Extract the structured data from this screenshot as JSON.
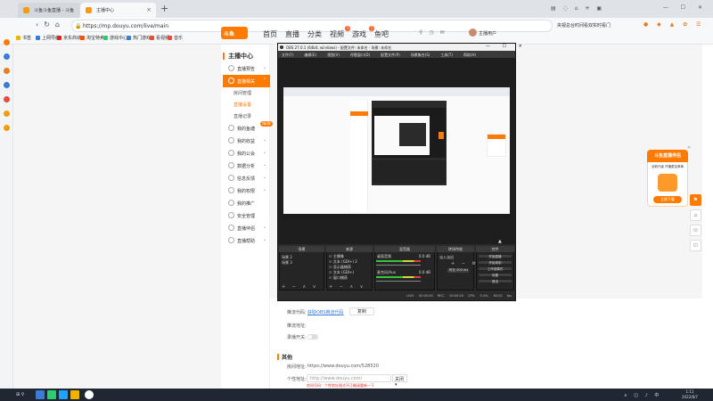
{
  "browser": {
    "tabs": [
      {
        "label": "斗鱼斗鱼直播 - 斗鱼"
      },
      {
        "label": "主播中心"
      }
    ],
    "new_tab": "+",
    "window_controls": "— ☐ ✕",
    "tab_icons": "▤ ◌ ⌂ ✳ ▣",
    "url": "https://mp.douyu.com/live/main",
    "search_hint": "央视总台时间看双实时看门",
    "bookmarks": [
      "书签",
      "上网导航",
      "京东商城",
      "淘宝特卖",
      "游戏中心",
      "热门游戏",
      "看视频",
      "音乐"
    ],
    "colors": {
      "accent": "#ff7a00"
    }
  },
  "site": {
    "logo": "斗鱼",
    "nav": [
      "首页",
      "直播",
      "分类",
      "视频",
      "游戏",
      "鱼吧"
    ],
    "nav_badges": {
      "video": "3",
      "game": "1"
    },
    "username": "主播用户"
  },
  "sidemenu": {
    "title": "主播中心",
    "items": [
      {
        "label": "直播预告",
        "chevron": "⌄"
      },
      {
        "label": "直播相关",
        "chevron": "⌃",
        "active": true
      },
      {
        "label": "我的鱼塘",
        "badge": "NEW"
      },
      {
        "label": "我的收益",
        "chevron": "⌄"
      },
      {
        "label": "我的公会",
        "chevron": "⌄"
      },
      {
        "label": "数据分析",
        "chevron": "⌄"
      },
      {
        "label": "信息反馈",
        "chevron": "⌄"
      },
      {
        "label": "我的权限",
        "chevron": "⌄"
      },
      {
        "label": "我的推广"
      },
      {
        "label": "安全管理"
      },
      {
        "label": "直播伴侣",
        "chevron": "⌄"
      },
      {
        "label": "直播帮助",
        "chevron": "⌄"
      }
    ],
    "subitems": [
      "房间管理",
      "直播设置",
      "直播记录"
    ]
  },
  "content": {
    "row1_label": "推流代码:",
    "row1_link": "获取OBS推流代码",
    "row1_btn": "复制",
    "row2_label": "推流地址:",
    "row3_label": "录播开关:",
    "section_other": "其他",
    "room_label": "房间地址:",
    "room_url": "https://www.douyu.com/528520",
    "custom_label": "个性地址:",
    "custom_placeholder": "http://www.douyu.com/",
    "close_select": "关闭 ▾",
    "error_text": "房间号码：个性地址格式不正确请重新一下"
  },
  "obs": {
    "title": "OBS 27.0.1 (64bit, windows) - 配置文件: 未命名 - 场景: 未命名",
    "window_controls": "— ☐ ✕",
    "menu": [
      "文件(F)",
      "编辑(E)",
      "视图(V)",
      "停靠窗口(D)",
      "配置文件(P)",
      "场景集合(S)",
      "工具(T)",
      "帮助(H)"
    ],
    "docks": {
      "scenes": "场景",
      "sources": "来源",
      "mixer": "混音器",
      "transitions": "转场特效",
      "controls": "控件"
    },
    "scenes": [
      "场景 2",
      "场景 3"
    ],
    "sources": [
      "☉ 主播像",
      "☉ 文本 (GDI+) 2",
      "☉ 显示器捕获",
      "☉ 文本 (GDI+)",
      "☉ 窗口捕获"
    ],
    "mixer": [
      "桌面音频",
      "麦克风/Aux"
    ],
    "mixer_db": [
      "0.0 dB",
      "0.0 dB"
    ],
    "transition": "淡入淡出",
    "transition_duration": "时长  300 ms",
    "controls": [
      "开始直播",
      "开始录制",
      "工作室模式",
      "设置",
      "退出"
    ],
    "dock_buttons": "+ − ∧ ∨",
    "status": "LIVE: 00:00:00   REC: 00:00:00   CPU: 5.4%, 60.00 fps",
    "cursor": "▲"
  },
  "promo": {
    "title": "斗鱼直播伴侣",
    "desc": "全新升级 开播更加简单",
    "button": "立即下载",
    "close": "✕"
  },
  "float_buttons": [
    "⚑",
    "⌂",
    "☏",
    "⊡"
  ],
  "taskbar": {
    "search": "⊞  ⚲",
    "tray": "∧ ◫ ♪ 中",
    "time": "1:11",
    "date": "2022/8/7"
  }
}
